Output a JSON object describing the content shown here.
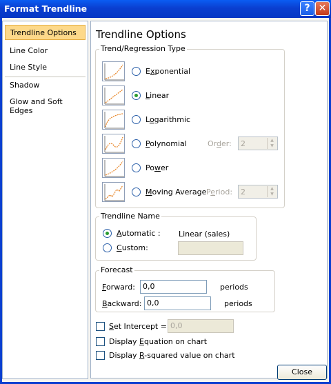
{
  "window": {
    "title": "Format Trendline",
    "help_label": "?",
    "close_label": "✕"
  },
  "sidebar": {
    "items": [
      {
        "label": "Trendline Options",
        "active": true
      },
      {
        "label": "Line Color"
      },
      {
        "label": "Line Style"
      },
      {
        "label": "Shadow"
      },
      {
        "label": "Glow and Soft Edges"
      }
    ]
  },
  "main": {
    "heading": "Trendline Options",
    "regression": {
      "group_label": "Trend/Regression Type",
      "options": [
        {
          "pre": "E",
          "key": "x",
          "post": "ponential",
          "icon": "exponential-icon",
          "selected": false
        },
        {
          "pre": "",
          "key": "L",
          "post": "inear",
          "icon": "linear-icon",
          "selected": true
        },
        {
          "pre": "L",
          "key": "o",
          "post": "garithmic",
          "icon": "logarithmic-icon",
          "selected": false
        },
        {
          "pre": "",
          "key": "P",
          "post": "olynomial",
          "icon": "polynomial-icon",
          "selected": false
        },
        {
          "pre": "Po",
          "key": "w",
          "post": "er",
          "icon": "power-icon",
          "selected": false
        },
        {
          "pre": "",
          "key": "M",
          "post": "oving Average",
          "icon": "moving-average-icon",
          "selected": false
        }
      ],
      "order": {
        "pre": "Or",
        "key": "d",
        "post": "er:",
        "value": "2"
      },
      "period": {
        "pre": "P",
        "key": "e",
        "post": "riod:",
        "value": "2"
      }
    },
    "trendline_name": {
      "group_label": "Trendline Name",
      "automatic": {
        "pre": "",
        "key": "A",
        "post": "utomatic :",
        "selected": true,
        "value": "Linear (sales)"
      },
      "custom": {
        "pre": "",
        "key": "C",
        "post": "ustom:",
        "selected": false,
        "value": ""
      }
    },
    "forecast": {
      "group_label": "Forecast",
      "forward": {
        "pre": "",
        "key": "F",
        "post": "orward:",
        "value": "0,0",
        "unit": "periods"
      },
      "backward": {
        "pre": "",
        "key": "B",
        "post": "ackward:",
        "value": "0,0",
        "unit": "periods"
      }
    },
    "set_intercept": {
      "pre": "",
      "key": "S",
      "post": "et Intercept =",
      "value": "0,0",
      "checked": false
    },
    "display_equation": {
      "pre": "Display ",
      "key": "E",
      "post": "quation on chart",
      "checked": false
    },
    "display_r_squared": {
      "pre": "Display ",
      "key": "R",
      "post": "-squared value on chart",
      "checked": false
    }
  },
  "footer": {
    "close_label": "Close"
  },
  "colors": {
    "title_bar": "#0a3fd0",
    "selected_tab": "#fdd98a",
    "radio_dot": "#2a9b30",
    "trend_line": "#e8872a"
  }
}
